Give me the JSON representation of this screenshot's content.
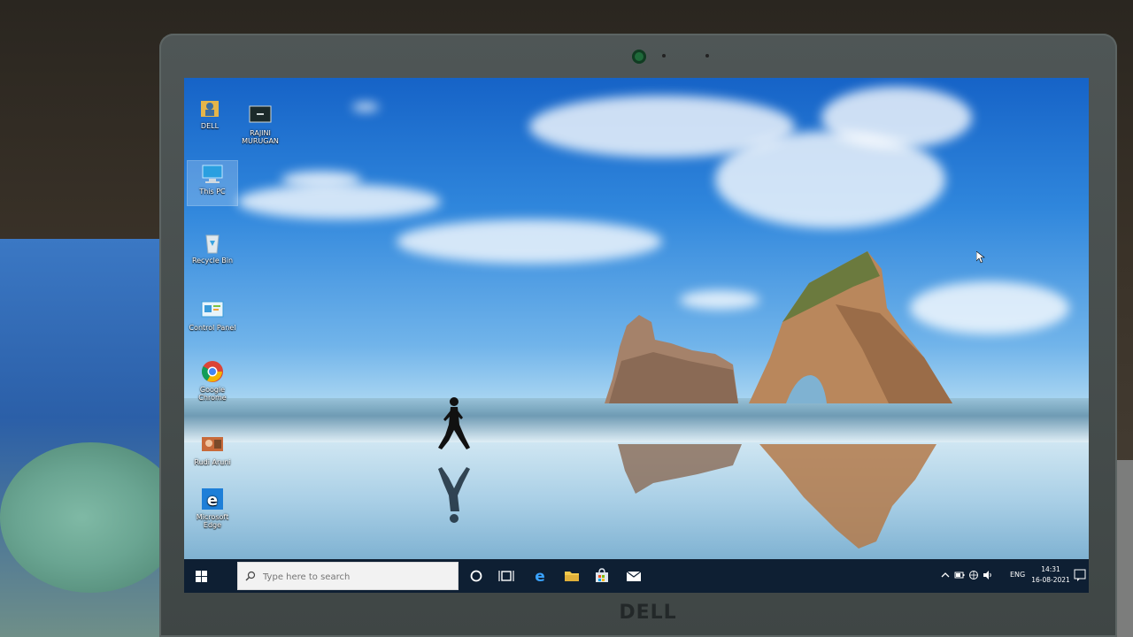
{
  "desktop": {
    "icons": [
      {
        "label": "DELL",
        "glyph": "user-folder-icon"
      },
      {
        "label": "RAJINI MURUGAN",
        "glyph": "shortcut-icon"
      },
      {
        "label": "This PC",
        "glyph": "computer-icon"
      },
      {
        "label": "Recycle Bin",
        "glyph": "recycle-bin-icon"
      },
      {
        "label": "Control Panel",
        "glyph": "control-panel-icon"
      },
      {
        "label": "Google Chrome",
        "glyph": "chrome-icon"
      },
      {
        "label": "Rudi Aruni",
        "glyph": "video-file-icon"
      },
      {
        "label": "Microsoft Edge",
        "glyph": "edge-icon"
      }
    ]
  },
  "taskbar": {
    "search_placeholder": "Type here to search",
    "pinned": [
      "cortana-icon",
      "task-view-icon",
      "edge-icon",
      "file-explorer-icon",
      "store-icon",
      "mail-icon"
    ],
    "tray": {
      "language": "ENG",
      "time": "14:31",
      "date": "16-08-2021"
    }
  },
  "laptop": {
    "brand": "DELL"
  },
  "colors": {
    "taskbar": "#0e1f33",
    "sky_top": "#1663c7",
    "sky_horizon": "#b9dff4"
  }
}
